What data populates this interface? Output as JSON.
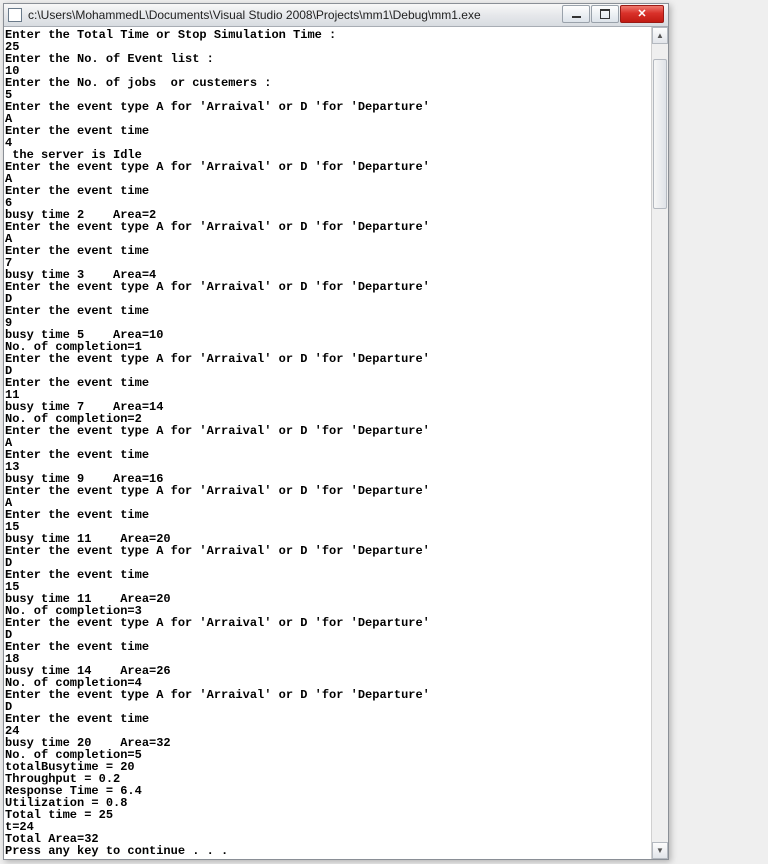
{
  "window": {
    "title": "c:\\Users\\MohammedL\\Documents\\Visual Studio 2008\\Projects\\mm1\\Debug\\mm1.exe"
  },
  "console": {
    "lines": [
      "Enter the Total Time or Stop Simulation Time :",
      "25",
      "Enter the No. of Event list :",
      "10",
      "Enter the No. of jobs  or custemers :",
      "5",
      "Enter the event type A for 'Arraival' or D 'for 'Departure'",
      "A",
      "Enter the event time",
      "4",
      " the server is Idle",
      "Enter the event type A for 'Arraival' or D 'for 'Departure'",
      "A",
      "Enter the event time",
      "6",
      "busy time 2    Area=2",
      "Enter the event type A for 'Arraival' or D 'for 'Departure'",
      "A",
      "Enter the event time",
      "7",
      "busy time 3    Area=4",
      "Enter the event type A for 'Arraival' or D 'for 'Departure'",
      "D",
      "Enter the event time",
      "9",
      "busy time 5    Area=10",
      "No. of completion=1",
      "Enter the event type A for 'Arraival' or D 'for 'Departure'",
      "D",
      "Enter the event time",
      "11",
      "busy time 7    Area=14",
      "No. of completion=2",
      "Enter the event type A for 'Arraival' or D 'for 'Departure'",
      "A",
      "Enter the event time",
      "13",
      "busy time 9    Area=16",
      "Enter the event type A for 'Arraival' or D 'for 'Departure'",
      "A",
      "Enter the event time",
      "15",
      "busy time 11    Area=20",
      "Enter the event type A for 'Arraival' or D 'for 'Departure'",
      "D",
      "Enter the event time",
      "15",
      "busy time 11    Area=20",
      "No. of completion=3",
      "Enter the event type A for 'Arraival' or D 'for 'Departure'",
      "D",
      "Enter the event time",
      "18",
      "busy time 14    Area=26",
      "No. of completion=4",
      "Enter the event type A for 'Arraival' or D 'for 'Departure'",
      "D",
      "Enter the event time",
      "24",
      "busy time 20    Area=32",
      "No. of completion=5",
      "totalBusytime = 20",
      "Throughput = 0.2",
      "Response Time = 6.4",
      "Utilization = 0.8",
      "Total time = 25",
      "t=24",
      "Total Area=32",
      "Press any key to continue . . ."
    ]
  }
}
